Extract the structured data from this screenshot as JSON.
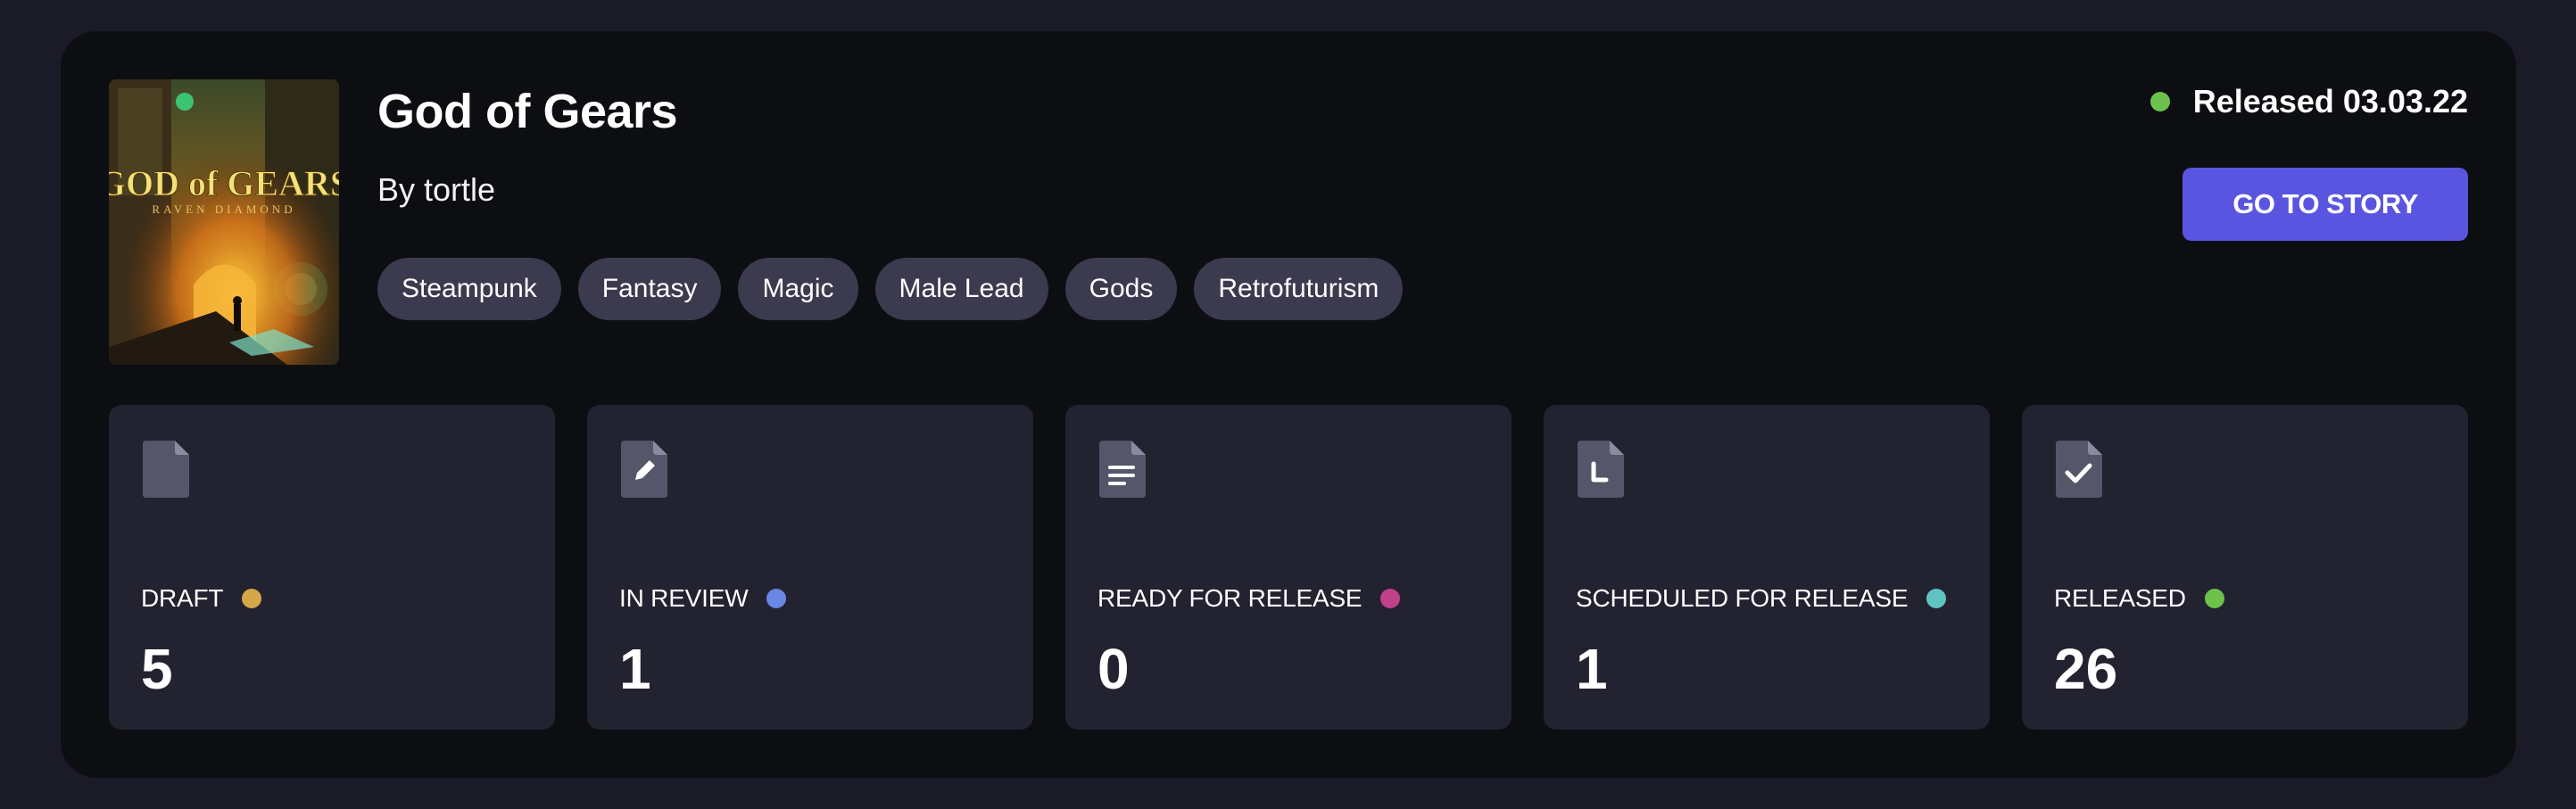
{
  "story": {
    "title": "God of Gears",
    "author": "By tortle",
    "cover_text": {
      "title": "GOD of GEARS",
      "subtitle": "RAVEN DIAMOND"
    },
    "tags": [
      "Steampunk",
      "Fantasy",
      "Magic",
      "Male Lead",
      "Gods",
      "Retrofuturism"
    ]
  },
  "status": {
    "text": "Released 03.03.22",
    "color": "#6cc24a"
  },
  "actions": {
    "go_to_story_label": "GO TO STORY"
  },
  "stats": [
    {
      "label": "DRAFT",
      "value": "5",
      "color": "#d4a849",
      "icon": "blank-document-icon"
    },
    {
      "label": "IN REVIEW",
      "value": "1",
      "color": "#6a86e6",
      "icon": "edit-document-icon"
    },
    {
      "label": "READY FOR RELEASE",
      "value": "0",
      "color": "#c0408a",
      "icon": "text-document-icon"
    },
    {
      "label": "SCHEDULED FOR RELEASE",
      "value": "1",
      "color": "#5fc4c0",
      "icon": "clock-document-icon"
    },
    {
      "label": "RELEASED",
      "value": "26",
      "color": "#6cc24a",
      "icon": "check-document-icon"
    }
  ],
  "colors": {
    "background": "#1b1b27",
    "card": "#0d0e12",
    "panel": "#222230",
    "tag": "#3b3a4e",
    "accent": "#5a55e0"
  }
}
